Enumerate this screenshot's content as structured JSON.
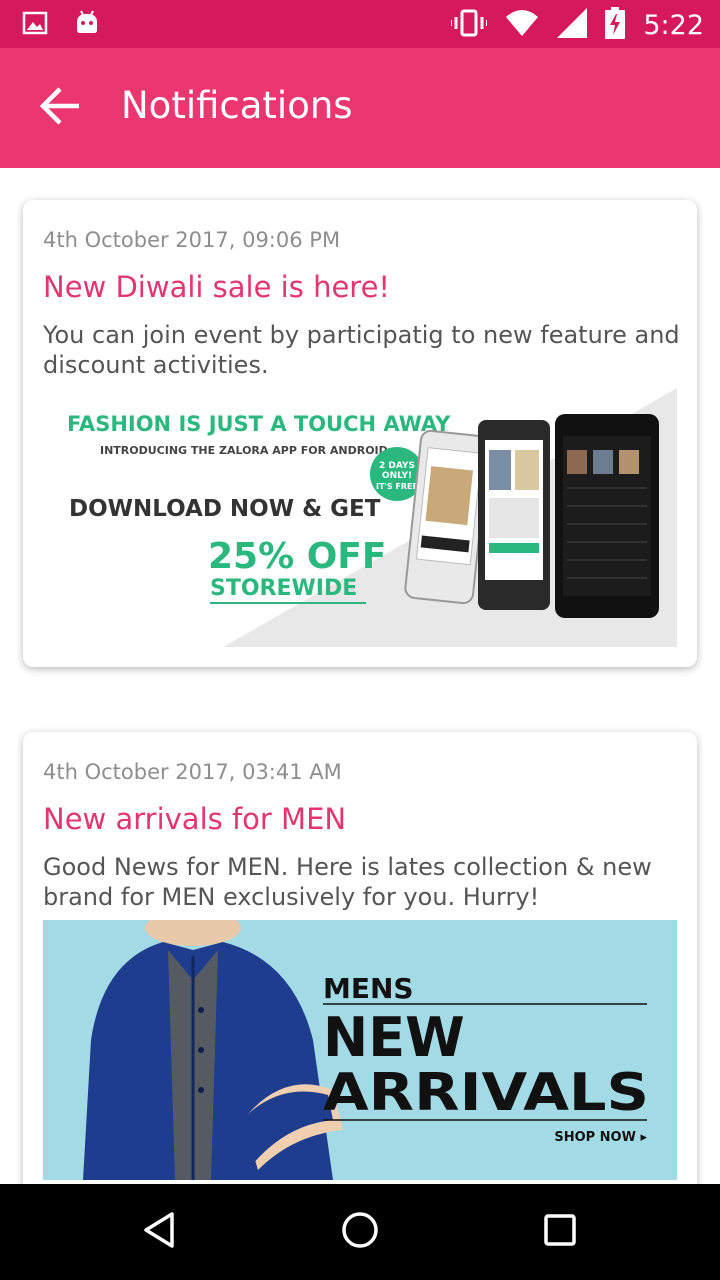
{
  "status_bar": {
    "time": "5:22",
    "icons": [
      "image-icon",
      "android-icon",
      "vibrate-icon",
      "wifi-icon",
      "signal-icon",
      "battery-charging-icon"
    ]
  },
  "app_bar": {
    "title": "Notifications",
    "back_icon": "arrow-back-icon"
  },
  "notifications": [
    {
      "date": "4th October 2017, 09:06 PM",
      "title": "New Diwali sale is here!",
      "body": "You can join event by participatig to new feature and discount activities.",
      "banner": {
        "headline": "FASHION IS JUST A TOUCH AWAY",
        "subheadline": "INTRODUCING THE ZALORA APP FOR ANDROID",
        "cta": "DOWNLOAD NOW & GET",
        "offer": "25% OFF",
        "offer_sub": "STOREWIDE",
        "badge_line1": "2 DAYS",
        "badge_line2": "ONLY!",
        "badge_line3": "IT'S FREE",
        "accent_color": "#2bb87e"
      }
    },
    {
      "date": "4th October 2017, 03:41 AM",
      "title": "New arrivals for MEN",
      "body": "Good News for MEN. Here is lates collection & new brand for MEN exclusively for you. Hurry!",
      "banner": {
        "line1": "MENS",
        "line2": "NEW",
        "line3": "ARRIVALS",
        "cta": "SHOP NOW ▸",
        "background_color": "#a2dbe6"
      }
    }
  ],
  "nav_bar": {
    "icons": [
      "back-triangle-icon",
      "home-circle-icon",
      "recents-square-icon"
    ]
  },
  "colors": {
    "status_bar": "#d6195a",
    "app_bar": "#ec3670",
    "title_accent": "#e33670"
  }
}
